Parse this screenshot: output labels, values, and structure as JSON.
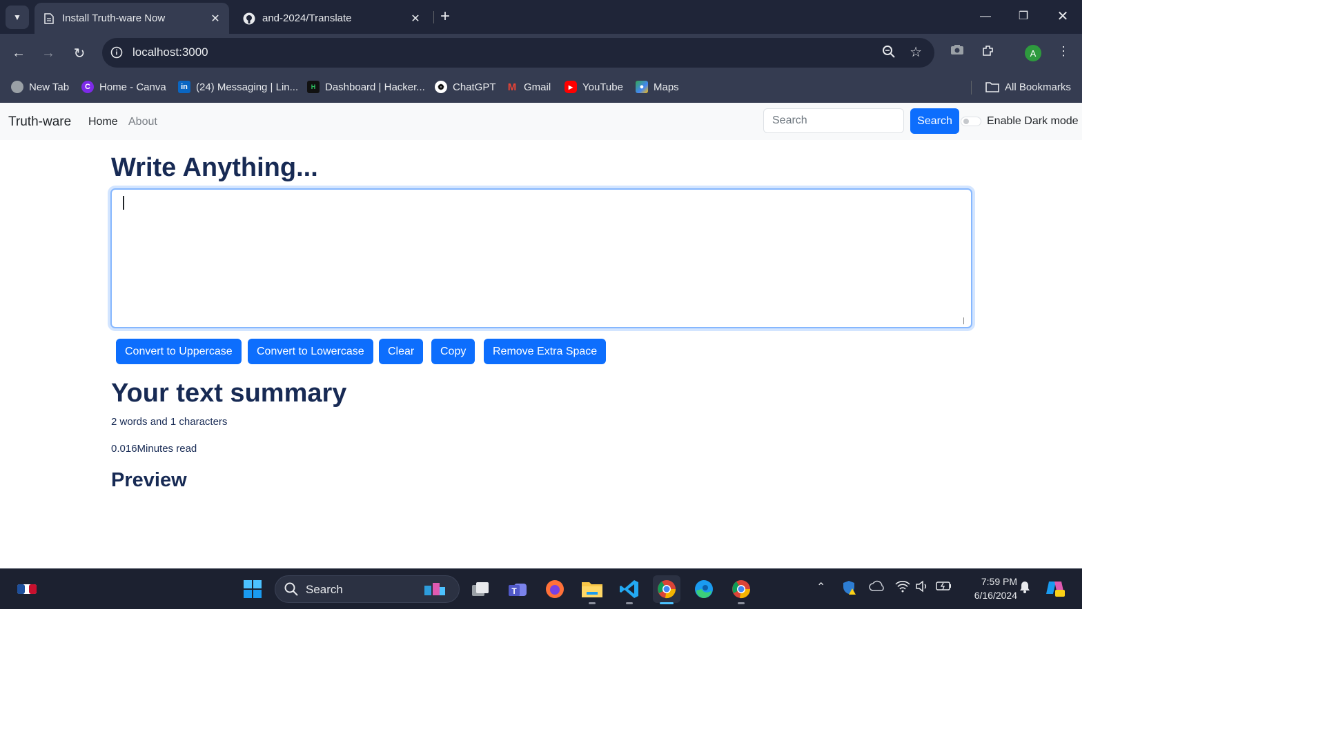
{
  "browser": {
    "tabs": [
      {
        "title": "Install Truth-ware Now",
        "active": true,
        "icon": "page-icon"
      },
      {
        "title": "and-2024/Translate",
        "active": false,
        "icon": "github-icon"
      }
    ],
    "url": "localhost:3000",
    "profile_initial": "A",
    "bookmarks": [
      {
        "label": "New Tab",
        "icon": "globe-icon",
        "color": "#9aa0a6"
      },
      {
        "label": "Home - Canva",
        "icon": "canva-icon",
        "color": "#7d2ae8"
      },
      {
        "label": "(24) Messaging | Lin...",
        "icon": "linkedin-icon",
        "color": "#0a66c2"
      },
      {
        "label": "Dashboard | Hacker...",
        "icon": "hackerrank-icon",
        "color": "#111111"
      },
      {
        "label": "ChatGPT",
        "icon": "chatgpt-icon",
        "color": "#ffffff"
      },
      {
        "label": "Gmail",
        "icon": "gmail-icon",
        "color": "#ea4335"
      },
      {
        "label": "YouTube",
        "icon": "youtube-icon",
        "color": "#ff0000"
      },
      {
        "label": "Maps",
        "icon": "maps-icon",
        "color": "#34a853"
      }
    ],
    "all_bookmarks_label": "All Bookmarks"
  },
  "navbar": {
    "brand": "Truth-ware",
    "links": [
      "Home",
      "About"
    ],
    "search_placeholder": "Search",
    "search_button": "Search",
    "dark_mode_label": "Enable Dark mode"
  },
  "main": {
    "heading": "Write Anything...",
    "textarea_value": "",
    "buttons": [
      "Convert to Uppercase",
      "Convert to Lowercase",
      "Clear",
      "Copy",
      "Remove Extra Space"
    ],
    "summary_heading": "Your text summary",
    "word_count_text": "2 words and 1 characters",
    "read_time_text": "0.016Minutes read",
    "preview_heading": "Preview"
  },
  "taskbar": {
    "search_label": "Search",
    "time": "7:59 PM",
    "date": "6/16/2024"
  },
  "colors": {
    "accent": "#0d6efd",
    "heading": "#172a54",
    "chrome_dark": "#1f2538",
    "chrome_mid": "#353c51"
  }
}
